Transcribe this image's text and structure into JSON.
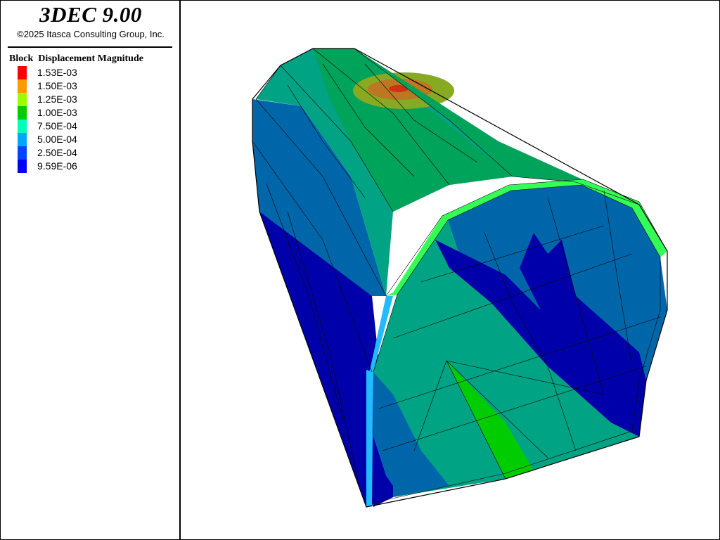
{
  "header": {
    "app_title": "3DEC 9.00",
    "copyright": "©2025 Itasca Consulting Group, Inc."
  },
  "legend": {
    "heading": "Block  Displacement Magnitude",
    "items": [
      {
        "label": "1.53E-03",
        "color": "#ff0000"
      },
      {
        "label": "1.50E-03",
        "color": "#ff9900"
      },
      {
        "label": "1.25E-03",
        "color": "#99ff00"
      },
      {
        "label": "1.00E-03",
        "color": "#00cc00"
      },
      {
        "label": "7.50E-04",
        "color": "#00ffbb"
      },
      {
        "label": "5.00E-04",
        "color": "#00a6ff"
      },
      {
        "label": "2.50E-04",
        "color": "#0045ff"
      },
      {
        "label": "9.59E-06",
        "color": "#0000ff"
      }
    ]
  },
  "model_colors": {
    "mesh_line": "#000000",
    "dark_blue": "#0000aa",
    "blue": "#0066aa",
    "teal": "#00a384",
    "green": "#00a35a",
    "bright_green": "#00cc00",
    "light_green": "#33ff55",
    "lime": "#88aa22",
    "orange": "#bb7722",
    "red": "#cc3311",
    "cyan": "#22bbff",
    "light_cyan": "#33ffaa"
  }
}
